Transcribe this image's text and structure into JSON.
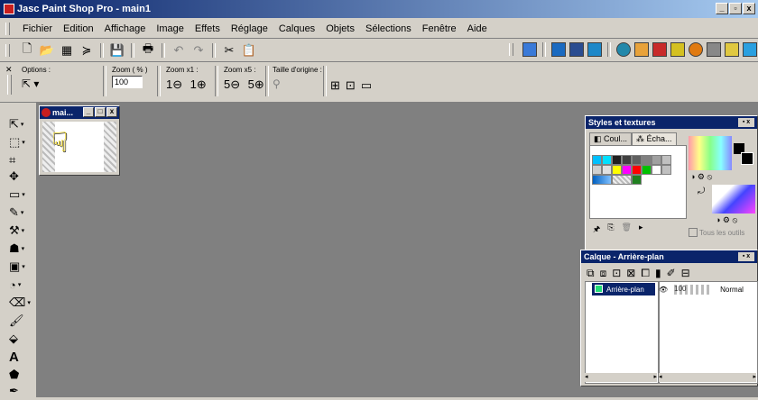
{
  "window": {
    "title": "Jasc Paint Shop Pro - main1"
  },
  "menubar": [
    "Fichier",
    "Edition",
    "Affichage",
    "Image",
    "Effets",
    "Réglage",
    "Calques",
    "Objets",
    "Sélections",
    "Fenêtre",
    "Aide"
  ],
  "options_bar": {
    "options_label": "Options :",
    "zoom_pct_label": "Zoom ( % )",
    "zoom_value": "100",
    "zoom_x1_label": "Zoom x1 :",
    "zoom_x5_label": "Zoom x5 :",
    "original_size_label": "Taille d'origine :"
  },
  "document": {
    "title": "mai..."
  },
  "styles_panel": {
    "title": "Styles et textures",
    "tab_colors": "Coul...",
    "tab_swatches": "Écha...",
    "all_tools_label": "Tous les outils"
  },
  "layers_panel": {
    "title": "Calque - Arrière-plan",
    "layer_name": "Arrière-plan",
    "opacity": "100",
    "blend_mode": "Normal"
  },
  "colors": {
    "title_bar": "#0a246a",
    "workspace": "#808080",
    "face": "#d4d0c8"
  }
}
